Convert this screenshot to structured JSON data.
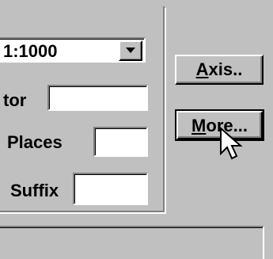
{
  "format": {
    "scale_combo": {
      "value": "1:1000"
    },
    "divisor_label": "tor",
    "divisor_value": "",
    "places_label": "Places",
    "places_value": "",
    "suffix_label": "Suffix",
    "suffix_value": ""
  },
  "buttons": {
    "axis": {
      "label_prefix": "",
      "accel": "A",
      "label_rest": "xis.."
    },
    "more": {
      "label_prefix": "",
      "accel": "M",
      "label_rest": "ore..."
    }
  },
  "colors": {
    "face": "#c0c0c0",
    "shadow": "#808080",
    "highlight": "#ffffff"
  },
  "icons": {
    "dropdown": "chevron-down-icon",
    "pointer": "arrow-cursor-icon"
  }
}
